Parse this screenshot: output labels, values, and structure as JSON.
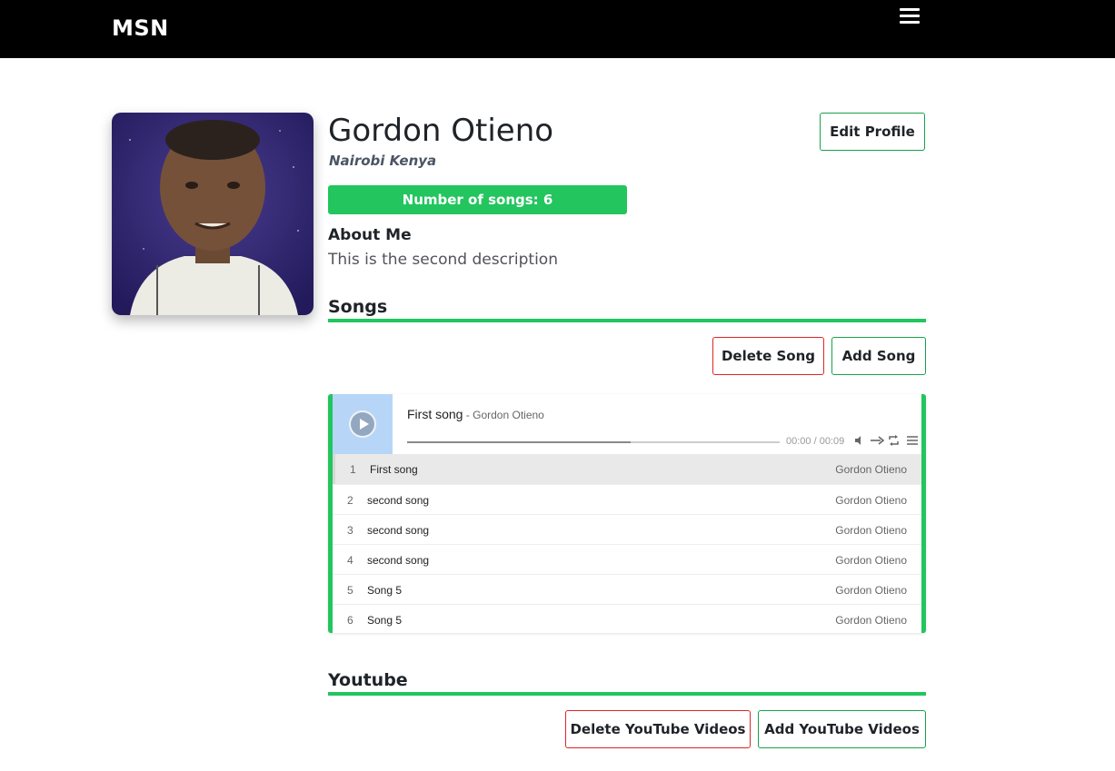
{
  "navbar": {
    "brand": "MSN",
    "menu_icon": "hamburger-menu-icon"
  },
  "profile": {
    "name": "Gordon Otieno",
    "location": "Nairobi Kenya",
    "edit_label": "Edit Profile",
    "song_count_label": "Number of songs: 6",
    "about_title": "About Me",
    "about_text": "This is the second description"
  },
  "songs_section": {
    "title": "Songs",
    "delete_label": "Delete Song",
    "add_label": "Add Song"
  },
  "player": {
    "now_playing_title": "First song",
    "now_playing_artist": " - Gordon Otieno",
    "time_display": "00:00 / 00:09",
    "played_fraction": 0.0,
    "loaded_fraction": 0.6,
    "icons": [
      "play-icon",
      "volume-icon",
      "order-icon",
      "loop-icon",
      "playlist-menu-icon"
    ],
    "accent": "#b7d6f7",
    "tracks": [
      {
        "index": "1",
        "title": "First song",
        "artist": "Gordon Otieno"
      },
      {
        "index": "2",
        "title": "second song",
        "artist": "Gordon Otieno"
      },
      {
        "index": "3",
        "title": "second song",
        "artist": "Gordon Otieno"
      },
      {
        "index": "4",
        "title": "second song",
        "artist": "Gordon Otieno"
      },
      {
        "index": "5",
        "title": "Song 5",
        "artist": "Gordon Otieno"
      },
      {
        "index": "6",
        "title": "Song 5",
        "artist": "Gordon Otieno"
      }
    ]
  },
  "youtube_section": {
    "title": "Youtube",
    "delete_label": "Delete YouTube Videos",
    "add_label": "Add YouTube Videos"
  },
  "colors": {
    "accent_green": "#22c55e",
    "danger_red": "#dc2626",
    "navbar": "#000000"
  }
}
